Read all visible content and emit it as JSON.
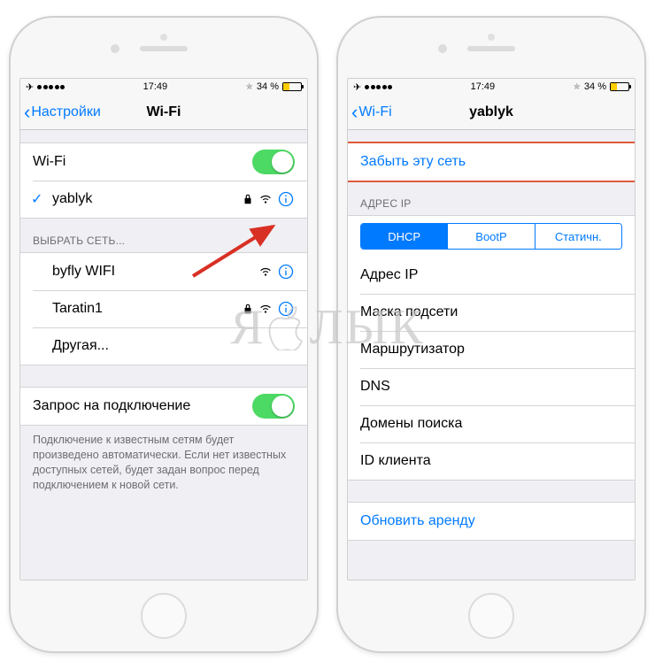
{
  "status": {
    "time": "17:49",
    "battery_pct": "34 %",
    "bluetooth": "bluetooth-icon",
    "airplane": "airplane-icon"
  },
  "left": {
    "back_label": "Настройки",
    "title": "Wi-Fi",
    "wifi_row_label": "Wi-Fi",
    "connected": "yablyk",
    "choose_header": "ВЫБРАТЬ СЕТЬ...",
    "net1": "byfly WIFI",
    "net2": "Taratin1",
    "other": "Другая...",
    "ask_label": "Запрос на подключение",
    "ask_note": "Подключение к известным сетям будет произведено автоматически. Если нет известных доступных сетей, будет задан вопрос перед подключением к новой сети."
  },
  "right": {
    "back_label": "Wi-Fi",
    "title": "yablyk",
    "forget": "Забыть эту сеть",
    "ip_header": "АДРЕС IP",
    "seg": {
      "dhcp": "DHCP",
      "bootp": "BootP",
      "static": "Статичн."
    },
    "rows": {
      "ip": "Адрес IP",
      "mask": "Маска подсети",
      "router": "Маршрутизатор",
      "dns": "DNS",
      "search": "Домены поиска",
      "client": "ID клиента"
    },
    "renew": "Обновить аренду"
  },
  "watermark": {
    "left": "Я",
    "right": "ЛЫК"
  }
}
